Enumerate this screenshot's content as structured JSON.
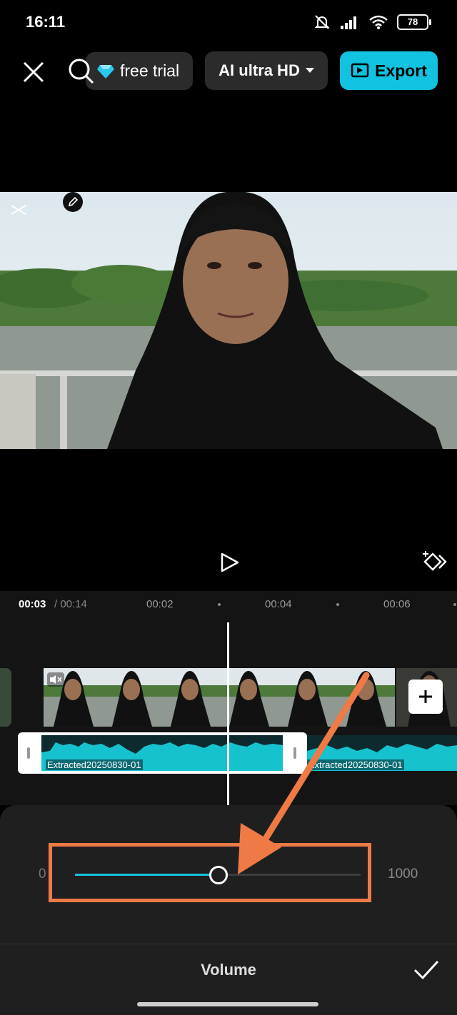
{
  "status_bar": {
    "time": "16:11",
    "battery": "78"
  },
  "toolbar": {
    "trial_label": "free trial",
    "quality_label": "AI ultra HD",
    "export_label": "Export"
  },
  "timeline": {
    "current_time": "00:03",
    "total_time": "/ 00:14",
    "ticks": [
      "00:02",
      "00:04",
      "00:06"
    ],
    "audio_clip_name": "Extracted20250830-01",
    "audio_clip_name_2": "Extracted20250830-01"
  },
  "volume_panel": {
    "title": "Volume",
    "min_label": "0",
    "max_label": "1000",
    "value_fraction": 0.5
  },
  "colors": {
    "accent": "#11c3e0",
    "highlight": "#f07a45"
  }
}
